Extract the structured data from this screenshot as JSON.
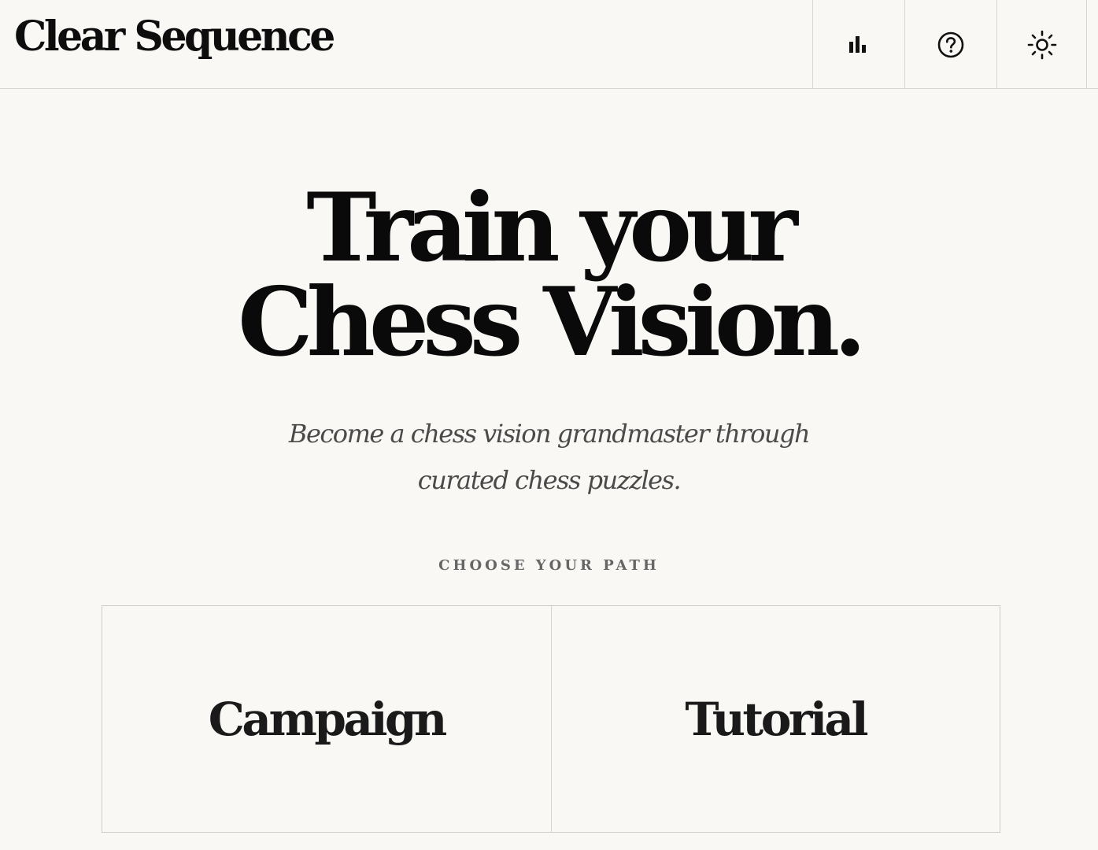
{
  "header": {
    "logo": "Clear Sequence",
    "buttons": [
      {
        "icon": "bar-chart-icon"
      },
      {
        "icon": "help-circle-icon"
      },
      {
        "icon": "sun-icon"
      }
    ]
  },
  "hero": {
    "title_line1": "Train your",
    "title_line2": "Chess Vision.",
    "subtitle_line1": "Become a chess vision grandmaster through",
    "subtitle_line2": "curated chess puzzles."
  },
  "paths": {
    "label": "CHOOSE YOUR PATH",
    "options": [
      {
        "label": "Campaign"
      },
      {
        "label": "Tutorial"
      }
    ]
  },
  "colors": {
    "background": "#f9f8f4",
    "text": "#0a0a0a",
    "muted": "#4a4a4a",
    "border": "#d9d7d2"
  }
}
